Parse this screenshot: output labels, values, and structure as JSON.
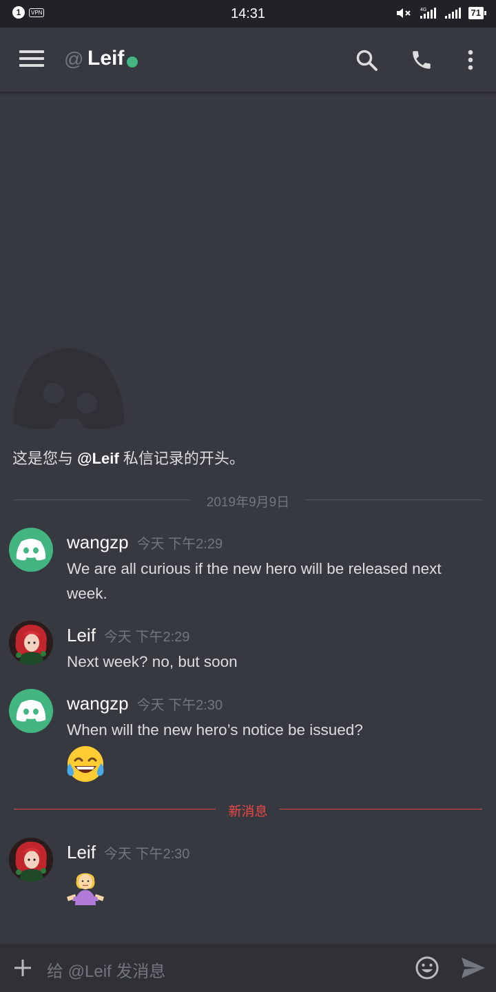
{
  "status_bar": {
    "notification_count": "1",
    "vpn_label": "VPN",
    "time": "14:31",
    "network_label": "4G",
    "battery": "71"
  },
  "header": {
    "at_symbol": "@",
    "title": "Leif",
    "online_status_color": "#43b581",
    "actions": [
      "search-icon",
      "phone-icon",
      "more-vertical-icon"
    ]
  },
  "welcome": {
    "prefix": "这是您与 ",
    "mention": "@Leif",
    "suffix": " 私信记录的开头。"
  },
  "date_divider": {
    "label": "2019年9月9日"
  },
  "new_divider": {
    "label": "新消息"
  },
  "messages": [
    {
      "author": "wangzp",
      "avatar": "discord-logo",
      "timestamp": "今天 下午2:29",
      "text": "We are all curious if the new hero will be released next week."
    },
    {
      "author": "Leif",
      "avatar": "character-portrait",
      "timestamp": "今天 下午2:29",
      "text": "Next week? no, but soon"
    },
    {
      "author": "wangzp",
      "avatar": "discord-logo",
      "timestamp": "今天 下午2:30",
      "text": "When will the new hero’s notice be issued?",
      "emoji": "face-with-tears-of-joy"
    },
    {
      "author": "Leif",
      "avatar": "character-portrait",
      "timestamp": "今天 下午2:30",
      "emoji": "person-shrugging"
    }
  ],
  "composer": {
    "placeholder": "给 @Leif 发消息",
    "icons": [
      "plus-icon",
      "emoji-icon",
      "send-icon"
    ]
  },
  "colors": {
    "background": "#36393f",
    "composer": "#2f3136",
    "accent_green": "#43b581",
    "new_messages_red": "#f04747",
    "muted_text": "#72767d"
  }
}
